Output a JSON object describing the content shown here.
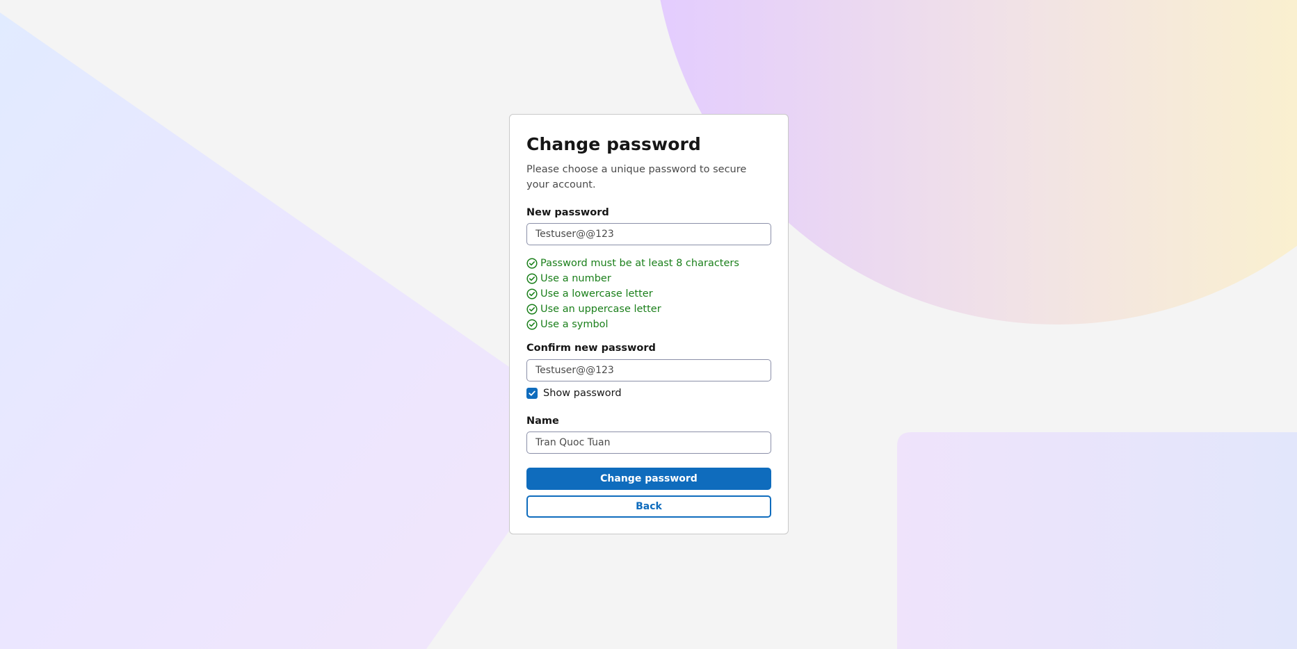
{
  "form": {
    "title": "Change password",
    "subtitle": "Please choose a unique password to secure your account.",
    "new_password": {
      "label": "New password",
      "value": "Testuser@@123"
    },
    "requirements": [
      "Password must be at least 8 characters",
      "Use a number",
      "Use a lowercase letter",
      "Use an uppercase letter",
      "Use a symbol"
    ],
    "confirm_password": {
      "label": "Confirm new password",
      "value": "Testuser@@123"
    },
    "show_password": {
      "label": "Show password",
      "checked": true
    },
    "name": {
      "label": "Name",
      "value": "Tran Quoc Tuan"
    },
    "submit_label": "Change password",
    "back_label": "Back"
  },
  "colors": {
    "accent": "#0f6cbd",
    "success": "#1a7f1a",
    "page_background": "#f4f4f4"
  },
  "icons": {
    "requirement": "check-circle-icon",
    "show_password": "checkbox-checked-icon"
  }
}
